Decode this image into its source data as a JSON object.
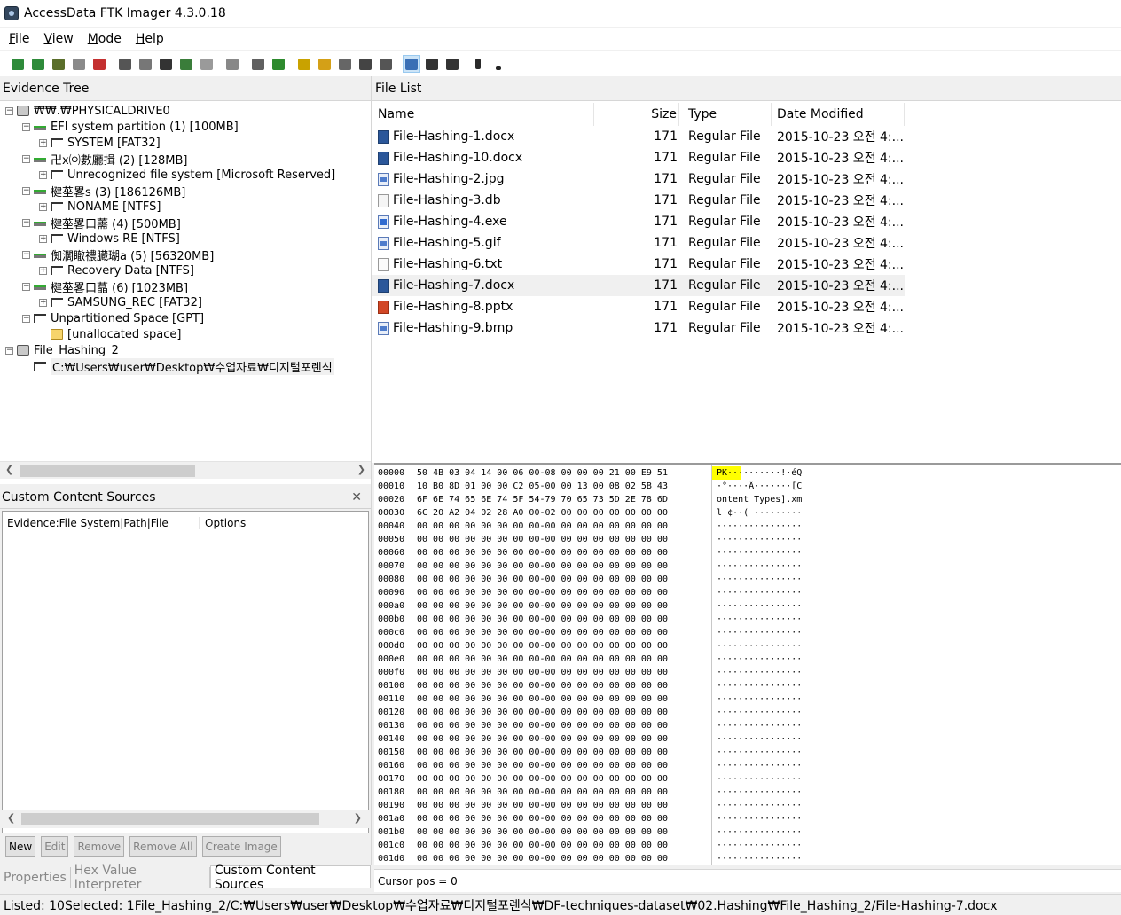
{
  "window": {
    "title": "AccessData FTK Imager 4.3.0.18"
  },
  "menu": [
    {
      "label": "File",
      "accel": "F"
    },
    {
      "label": "View",
      "accel": "V"
    },
    {
      "label": "Mode",
      "accel": "M"
    },
    {
      "label": "Help",
      "accel": "H"
    }
  ],
  "toolbar": {
    "icons": [
      "add-evidence-icon",
      "add-all-evidence-icon",
      "image-mounting-icon",
      "remove-evidence-icon",
      "remove-all-evidence-icon",
      "create-disk-image-icon",
      "export-disk-image-icon",
      "export-logical-image-icon",
      "add-to-custom-content-icon",
      "create-custom-image-icon",
      "decrypt-ad1-icon",
      "verify-drive-icon",
      "capture-memory-icon",
      "obtain-protected-files-icon",
      "detect-efs-icon",
      "export-files-icon",
      "export-file-hash-list-icon",
      "export-directory-listing-icon",
      "auto-view-icon",
      "text-view-icon",
      "hex-view-icon",
      "help-icon",
      "dropdown-icon"
    ],
    "colors": [
      "#2e8b3a",
      "#2e8b3a",
      "#5a6e2a",
      "#8a8a8a",
      "#c43030",
      "#555555",
      "#777777",
      "#333333",
      "#3a7d3a",
      "#9a9a9a",
      "#888888",
      "#606060",
      "#2d8a2d",
      "#c9a200",
      "#d4a017",
      "#666666",
      "#444444",
      "#555555",
      "#3a6fb5",
      "#333333",
      "#333333",
      "#2a2a2a",
      "#222222"
    ]
  },
  "evidence_tree": {
    "header": "Evidence Tree",
    "nodes": [
      {
        "label": "₩₩.₩PHYSICALDRIVE0",
        "depth": 0,
        "expander": "−",
        "icon": "drive"
      },
      {
        "label": "EFI system partition (1) [100MB]",
        "depth": 1,
        "expander": "−",
        "icon": "partition"
      },
      {
        "label": "SYSTEM [FAT32]",
        "depth": 2,
        "expander": "+",
        "icon": "filesystem"
      },
      {
        "label": "卍ⅹ㈇數廳揖 (2) [128MB]",
        "depth": 1,
        "expander": "−",
        "icon": "partition"
      },
      {
        "label": "Unrecognized file system [Microsoft Reserved]",
        "depth": 2,
        "expander": "+",
        "icon": "filesystem"
      },
      {
        "label": "楗莝畧s (3) [186126MB]",
        "depth": 1,
        "expander": "−",
        "icon": "partition"
      },
      {
        "label": "NONAME [NTFS]",
        "depth": 2,
        "expander": "+",
        "icon": "filesystem"
      },
      {
        "label": "楗莝畧口薷 (4) [500MB]",
        "depth": 1,
        "expander": "−",
        "icon": "partition"
      },
      {
        "label": "Windows RE [NTFS]",
        "depth": 2,
        "expander": "+",
        "icon": "filesystem"
      },
      {
        "label": "倁濶瞮禯臓瑚a (5) [56320MB]",
        "depth": 1,
        "expander": "−",
        "icon": "partition"
      },
      {
        "label": "Recovery Data [NTFS]",
        "depth": 2,
        "expander": "+",
        "icon": "filesystem"
      },
      {
        "label": "楗莝畧口蕌 (6) [1023MB]",
        "depth": 1,
        "expander": "−",
        "icon": "partition"
      },
      {
        "label": "SAMSUNG_REC [FAT32]",
        "depth": 2,
        "expander": "+",
        "icon": "filesystem"
      },
      {
        "label": "Unpartitioned Space [GPT]",
        "depth": 1,
        "expander": "−",
        "icon": "filesystem"
      },
      {
        "label": "[unallocated space]",
        "depth": 2,
        "expander": "",
        "icon": "folder"
      },
      {
        "label": "File_Hashing_2",
        "depth": 0,
        "expander": "−",
        "icon": "drive"
      },
      {
        "label": "C:₩Users₩user₩Desktop₩수업자료₩디지털포렌식",
        "depth": 1,
        "expander": "",
        "icon": "filesystem"
      }
    ]
  },
  "custom_content": {
    "header": "Custom Content Sources",
    "columns": [
      "Evidence:File System|Path|File",
      "Options"
    ],
    "buttons": [
      {
        "label": "New",
        "enabled": true
      },
      {
        "label": "Edit",
        "enabled": false
      },
      {
        "label": "Remove",
        "enabled": false
      },
      {
        "label": "Remove All",
        "enabled": false
      },
      {
        "label": "Create Image",
        "enabled": false
      }
    ]
  },
  "bottom_tabs": [
    {
      "label": "Properties",
      "active": false
    },
    {
      "label": "Hex Value Interpreter",
      "active": false
    },
    {
      "label": "Custom Content Sources",
      "active": true
    }
  ],
  "file_list": {
    "header": "File List",
    "columns": [
      "Name",
      "Size",
      "Type",
      "Date Modified"
    ],
    "rows": [
      {
        "name": "File-Hashing-1.docx",
        "size": "171",
        "type": "Regular File",
        "date": "2015-10-23 오전 4:...",
        "icon": "word",
        "selected": false
      },
      {
        "name": "File-Hashing-10.docx",
        "size": "171",
        "type": "Regular File",
        "date": "2015-10-23 오전 4:...",
        "icon": "word",
        "selected": false
      },
      {
        "name": "File-Hashing-2.jpg",
        "size": "171",
        "type": "Regular File",
        "date": "2015-10-23 오전 4:...",
        "icon": "img",
        "selected": false
      },
      {
        "name": "File-Hashing-3.db",
        "size": "171",
        "type": "Regular File",
        "date": "2015-10-23 오전 4:...",
        "icon": "db",
        "selected": false
      },
      {
        "name": "File-Hashing-4.exe",
        "size": "171",
        "type": "Regular File",
        "date": "2015-10-23 오전 4:...",
        "icon": "exe",
        "selected": false
      },
      {
        "name": "File-Hashing-5.gif",
        "size": "171",
        "type": "Regular File",
        "date": "2015-10-23 오전 4:...",
        "icon": "img",
        "selected": false
      },
      {
        "name": "File-Hashing-6.txt",
        "size": "171",
        "type": "Regular File",
        "date": "2015-10-23 오전 4:...",
        "icon": "txt",
        "selected": false
      },
      {
        "name": "File-Hashing-7.docx",
        "size": "171",
        "type": "Regular File",
        "date": "2015-10-23 오전 4:...",
        "icon": "word",
        "selected": true
      },
      {
        "name": "File-Hashing-8.pptx",
        "size": "171",
        "type": "Regular File",
        "date": "2015-10-23 오전 4:...",
        "icon": "ppt",
        "selected": false
      },
      {
        "name": "File-Hashing-9.bmp",
        "size": "171",
        "type": "Regular File",
        "date": "2015-10-23 오전 4:...",
        "icon": "img",
        "selected": false
      }
    ]
  },
  "hex_view": {
    "lines": [
      {
        "offset": "00000",
        "bytes": "50 4B 03 04 14 00 06 00-08 00 00 00 21 00 E9 51",
        "ascii": "PK··········!·éQ"
      },
      {
        "offset": "00010",
        "bytes": "10 B0 8D 01 00 00 C2 05-00 00 13 00 08 02 5B 43",
        "ascii": "·°····Â·······[C"
      },
      {
        "offset": "00020",
        "bytes": "6F 6E 74 65 6E 74 5F 54-79 70 65 73 5D 2E 78 6D",
        "ascii": "ontent_Types].xm"
      },
      {
        "offset": "00030",
        "bytes": "6C 20 A2 04 02 28 A0 00-02 00 00 00 00 00 00 00",
        "ascii": "l ¢··( ·········"
      },
      {
        "offset": "00040",
        "bytes": "00 00 00 00 00 00 00 00-00 00 00 00 00 00 00 00",
        "ascii": "················"
      },
      {
        "offset": "00050",
        "bytes": "00 00 00 00 00 00 00 00-00 00 00 00 00 00 00 00",
        "ascii": "················"
      },
      {
        "offset": "00060",
        "bytes": "00 00 00 00 00 00 00 00-00 00 00 00 00 00 00 00",
        "ascii": "················"
      },
      {
        "offset": "00070",
        "bytes": "00 00 00 00 00 00 00 00-00 00 00 00 00 00 00 00",
        "ascii": "················"
      },
      {
        "offset": "00080",
        "bytes": "00 00 00 00 00 00 00 00-00 00 00 00 00 00 00 00",
        "ascii": "················"
      },
      {
        "offset": "00090",
        "bytes": "00 00 00 00 00 00 00 00-00 00 00 00 00 00 00 00",
        "ascii": "················"
      },
      {
        "offset": "000a0",
        "bytes": "00 00 00 00 00 00 00 00-00 00 00 00 00 00 00 00",
        "ascii": "················"
      },
      {
        "offset": "000b0",
        "bytes": "00 00 00 00 00 00 00 00-00 00 00 00 00 00 00 00",
        "ascii": "················"
      },
      {
        "offset": "000c0",
        "bytes": "00 00 00 00 00 00 00 00-00 00 00 00 00 00 00 00",
        "ascii": "················"
      },
      {
        "offset": "000d0",
        "bytes": "00 00 00 00 00 00 00 00-00 00 00 00 00 00 00 00",
        "ascii": "················"
      },
      {
        "offset": "000e0",
        "bytes": "00 00 00 00 00 00 00 00-00 00 00 00 00 00 00 00",
        "ascii": "················"
      },
      {
        "offset": "000f0",
        "bytes": "00 00 00 00 00 00 00 00-00 00 00 00 00 00 00 00",
        "ascii": "················"
      },
      {
        "offset": "00100",
        "bytes": "00 00 00 00 00 00 00 00-00 00 00 00 00 00 00 00",
        "ascii": "················"
      },
      {
        "offset": "00110",
        "bytes": "00 00 00 00 00 00 00 00-00 00 00 00 00 00 00 00",
        "ascii": "················"
      },
      {
        "offset": "00120",
        "bytes": "00 00 00 00 00 00 00 00-00 00 00 00 00 00 00 00",
        "ascii": "················"
      },
      {
        "offset": "00130",
        "bytes": "00 00 00 00 00 00 00 00-00 00 00 00 00 00 00 00",
        "ascii": "················"
      },
      {
        "offset": "00140",
        "bytes": "00 00 00 00 00 00 00 00-00 00 00 00 00 00 00 00",
        "ascii": "················"
      },
      {
        "offset": "00150",
        "bytes": "00 00 00 00 00 00 00 00-00 00 00 00 00 00 00 00",
        "ascii": "················"
      },
      {
        "offset": "00160",
        "bytes": "00 00 00 00 00 00 00 00-00 00 00 00 00 00 00 00",
        "ascii": "················"
      },
      {
        "offset": "00170",
        "bytes": "00 00 00 00 00 00 00 00-00 00 00 00 00 00 00 00",
        "ascii": "················"
      },
      {
        "offset": "00180",
        "bytes": "00 00 00 00 00 00 00 00-00 00 00 00 00 00 00 00",
        "ascii": "················"
      },
      {
        "offset": "00190",
        "bytes": "00 00 00 00 00 00 00 00-00 00 00 00 00 00 00 00",
        "ascii": "················"
      },
      {
        "offset": "001a0",
        "bytes": "00 00 00 00 00 00 00 00-00 00 00 00 00 00 00 00",
        "ascii": "················"
      },
      {
        "offset": "001b0",
        "bytes": "00 00 00 00 00 00 00 00-00 00 00 00 00 00 00 00",
        "ascii": "················"
      },
      {
        "offset": "001c0",
        "bytes": "00 00 00 00 00 00 00 00-00 00 00 00 00 00 00 00",
        "ascii": "················"
      },
      {
        "offset": "001d0",
        "bytes": "00 00 00 00 00 00 00 00-00 00 00 00 00 00 00 00",
        "ascii": "················"
      }
    ],
    "highlight_color": "#ffff00"
  },
  "cursor_pos": "Cursor pos = 0",
  "status": "Listed: 10Selected: 1File_Hashing_2/C:₩Users₩user₩Desktop₩수업자료₩디지털포렌식₩DF-techniques-dataset₩02.Hashing₩File_Hashing_2/File-Hashing-7.docx"
}
